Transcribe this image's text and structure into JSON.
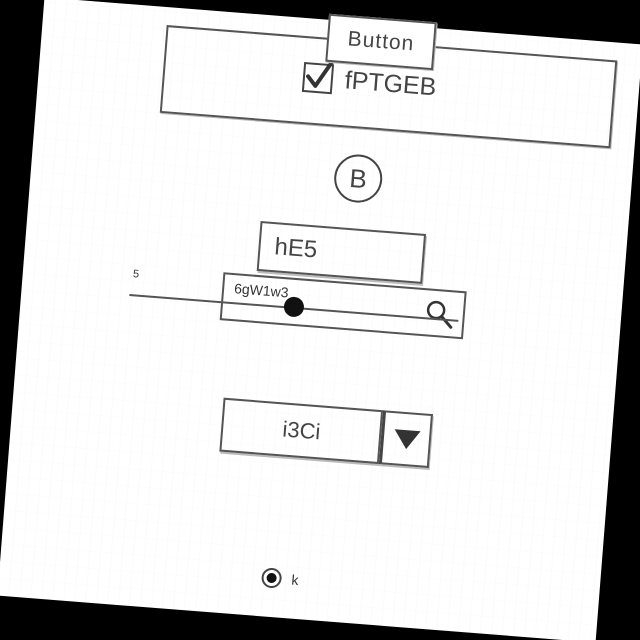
{
  "buttons": {
    "top_label": "Button",
    "circle_label": "B"
  },
  "checkbox": {
    "label": "fPTGEB",
    "checked": true
  },
  "text_field": {
    "value": "hE5"
  },
  "slider": {
    "value_label": "5",
    "fill_fraction": 0.5
  },
  "search": {
    "value": "6gW1w3",
    "icon": "search-icon"
  },
  "dropdown": {
    "selected": "i3Ci",
    "icon": "triangle-down-icon"
  },
  "radio": {
    "label": "k",
    "selected": true
  }
}
